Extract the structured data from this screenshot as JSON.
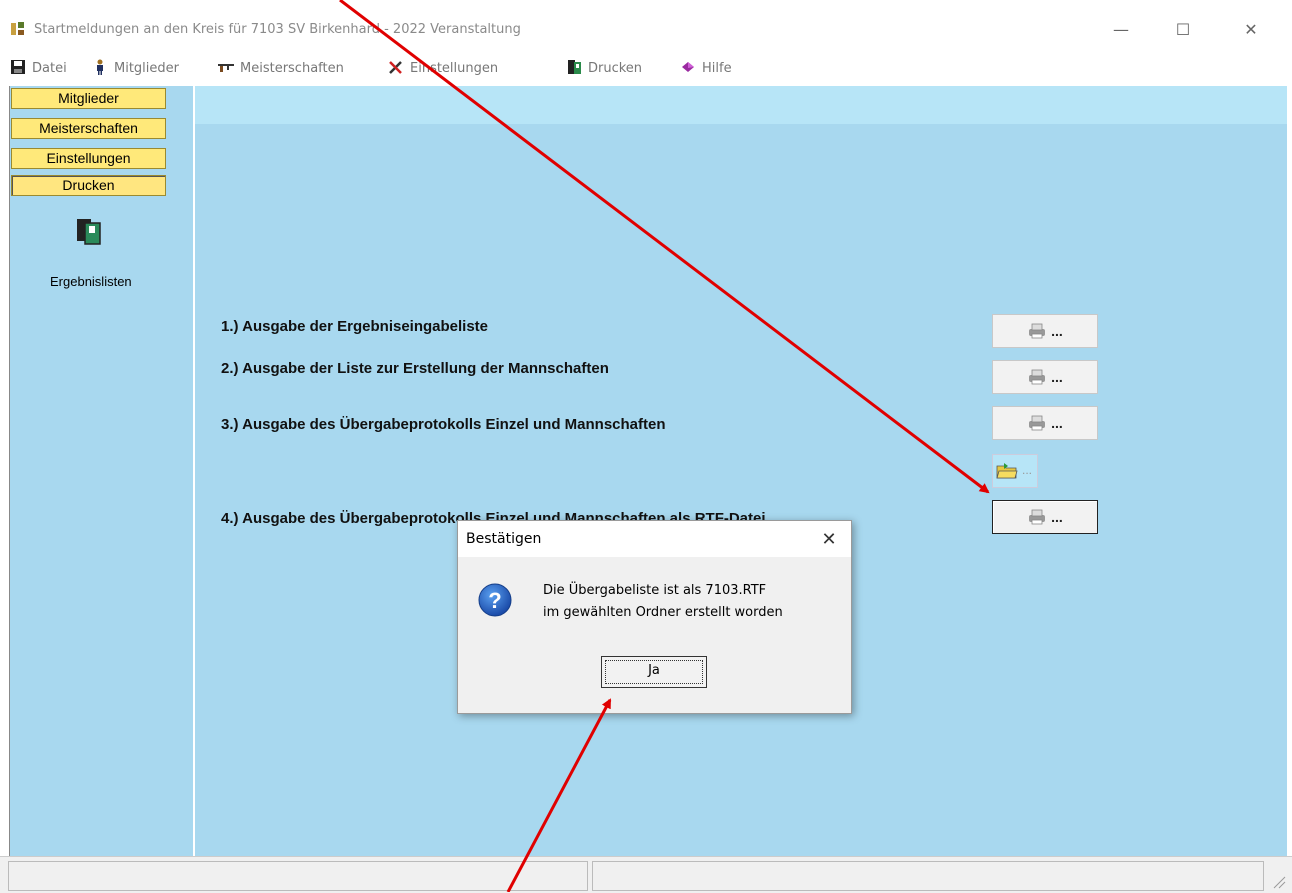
{
  "window": {
    "title": "Startmeldungen an den Kreis für 7103 SV Birkenhard - 2022  Veranstaltung",
    "controls": {
      "minimize": "—",
      "maximize": "☐",
      "close": "✕"
    }
  },
  "menubar": {
    "items": [
      {
        "label": "Datei",
        "icon": "save-disk-icon"
      },
      {
        "label": "Mitglieder",
        "icon": "person-icon"
      },
      {
        "label": "Meisterschaften",
        "icon": "rifle-icon"
      },
      {
        "label": "Einstellungen",
        "icon": "tools-icon"
      },
      {
        "label": "Drucken",
        "icon": "print-preview-icon"
      },
      {
        "label": "Hilfe",
        "icon": "help-book-icon"
      }
    ]
  },
  "sidebar": {
    "tabs": [
      "Mitglieder",
      "Meisterschaften",
      "Einstellungen",
      "Drucken"
    ],
    "active_tab": "Drucken",
    "item_label": "Ergebnislisten",
    "item_icon": "document-pages-icon"
  },
  "main": {
    "rows": [
      {
        "label": "1.)  Ausgabe der Ergebniseingabeliste",
        "button": "..."
      },
      {
        "label": "2.)  Ausgabe der Liste zur Erstellung der Mannschaften",
        "button": "..."
      },
      {
        "label": "3.)  Ausgabe des Übergabeprotokolls Einzel und Mannschaften",
        "button": "..."
      },
      {
        "label": "4.)  Ausgabe des Übergabeprotokolls Einzel und Mannschaften als RTF-Datei",
        "button": "..."
      }
    ],
    "folder_button": "..."
  },
  "dialog": {
    "title": "Bestätigen",
    "close": "✕",
    "icon": "question-icon",
    "line1": "Die Übergabeliste ist als  7103.RTF",
    "line2": "im gewählten Ordner erstellt worden",
    "ok_label": "Ja"
  },
  "colors": {
    "panel": "#a8d8ef",
    "panel_top": "#b7e5f7",
    "tab": "#ffe97a",
    "annotation_arrow": "#e00000"
  }
}
